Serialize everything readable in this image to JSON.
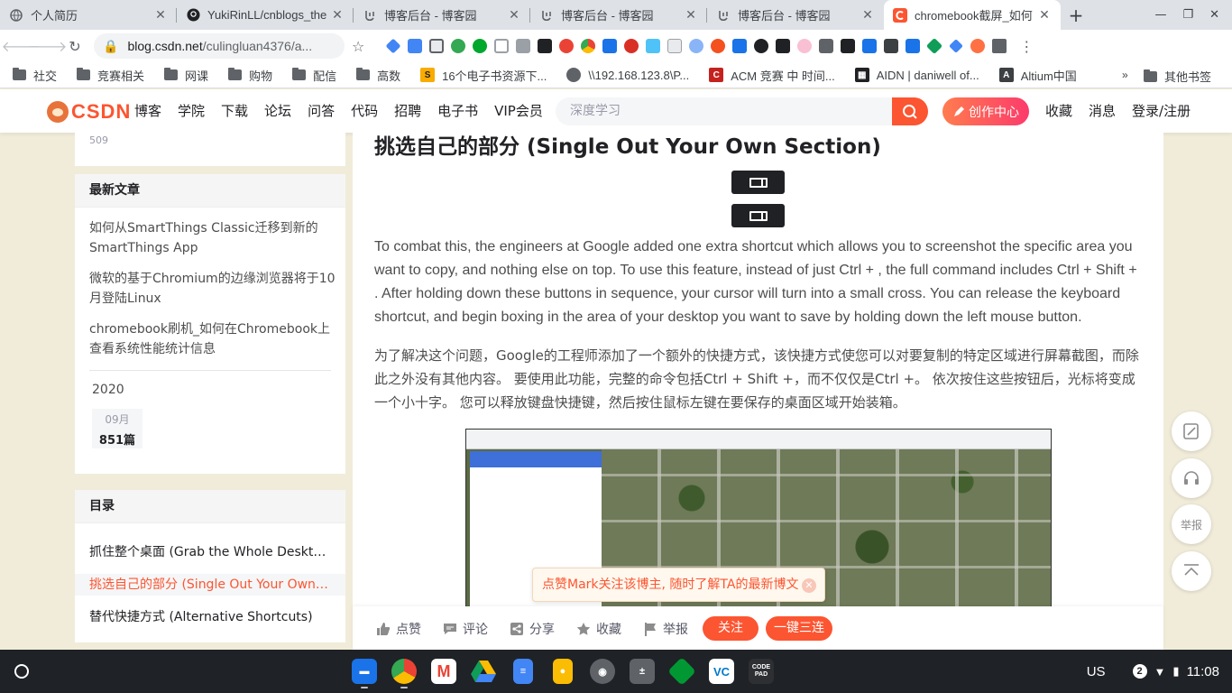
{
  "browser": {
    "tabs": [
      {
        "title": "个人简历",
        "icon": "globe-icon",
        "active": false
      },
      {
        "title": "YukiRinLL/cnblogs_the",
        "icon": "github-icon",
        "active": false
      },
      {
        "title": "博客后台 - 博客园",
        "icon": "cnblogs-icon",
        "active": false
      },
      {
        "title": "博客后台 - 博客园",
        "icon": "cnblogs-icon",
        "active": false
      },
      {
        "title": "博客后台 - 博客园",
        "icon": "cnblogs-icon",
        "active": false
      },
      {
        "title": "chromebook截屏_如何",
        "icon": "csdn-icon",
        "active": true
      }
    ],
    "url_host": "blog.csdn.net",
    "url_path": "/culingluan4376/a...",
    "bookmarks": [
      {
        "label": "社交",
        "type": "folder"
      },
      {
        "label": "竞赛相关",
        "type": "folder"
      },
      {
        "label": "网课",
        "type": "folder"
      },
      {
        "label": "购物",
        "type": "folder"
      },
      {
        "label": "配信",
        "type": "folder"
      },
      {
        "label": "高数",
        "type": "folder"
      },
      {
        "label": "16个电子书资源下...",
        "type": "site",
        "icon": "s-icon"
      },
      {
        "label": "\\\\192.168.123.8\\P...",
        "type": "site",
        "icon": "globe-icon"
      },
      {
        "label": "ACM 竞赛 中 时间...",
        "type": "site",
        "icon": "c-icon"
      },
      {
        "label": "AIDN | daniwell of...",
        "type": "site",
        "icon": "qr-icon"
      },
      {
        "label": "Altium中国",
        "type": "site",
        "icon": "altium-icon"
      }
    ],
    "bookmarks_more": "»",
    "bookmarks_other": "其他书签"
  },
  "csdn": {
    "logo_text": "CSDN",
    "nav": [
      "博客",
      "学院",
      "下载",
      "论坛",
      "问答",
      "代码",
      "招聘",
      "电子书",
      "VIP会员"
    ],
    "search_placeholder": "深度学习",
    "create_label": "创作中心",
    "right_nav": [
      "收藏",
      "消息",
      "登录/注册"
    ]
  },
  "sidebar": {
    "count_top": "509",
    "recent_title": "最新文章",
    "recent_articles": [
      "如何从SmartThings Classic迁移到新的SmartThings App",
      "微软的基于Chromium的边缘浏览器将于10月登陆Linux",
      "chromebook刷机_如何在Chromebook上查看系统性能统计信息"
    ],
    "archive_year": "2020",
    "archive_month": "09月",
    "archive_count": "851篇",
    "toc_title": "目录",
    "toc_items": [
      {
        "label": "抓住整个桌面 (Grab the Whole Desktop)",
        "active": false
      },
      {
        "label": "挑选自己的部分 (Single Out Your Own Section)",
        "active": true
      },
      {
        "label": "替代快捷方式 (Alternative Shortcuts)",
        "active": false
      }
    ]
  },
  "article": {
    "heading": "挑选自己的部分 (Single Out Your Own Section)",
    "para_en": "To combat this, the engineers at Google added one extra shortcut which allows you to screenshot the specific area you want to copy, and nothing else on top. To use this feature, instead of just Ctrl + , the full command includes Ctrl + Shift + . After holding down these buttons in sequence, your cursor will turn into a small cross. You can release the keyboard shortcut, and begin boxing in the area of your desktop you want to save by holding down the left mouse button.",
    "para_zh": "为了解决这个问题，Google的工程师添加了一个额外的快捷方式，该快捷方式使您可以对要复制的特定区域进行屏幕截图，而除此之外没有其他内容。 要使用此功能，完整的命令包括Ctrl + Shift +，而不仅仅是Ctrl +。 依次按住这些按钮后，光标将变成一个小十字。 您可以释放键盘快捷键，然后按住鼠标左键在要保存的桌面区域开始装箱。",
    "toast_text": "点赞Mark关注该博主, 随时了解TA的最新博文"
  },
  "actions": {
    "like": "点赞",
    "comment": "评论",
    "share": "分享",
    "favorite": "收藏",
    "report": "举报",
    "follow": "关注",
    "triple": "一键三连"
  },
  "float_tools": {
    "report": "举报"
  },
  "shelf": {
    "apps": [
      "files",
      "chrome",
      "gmail",
      "drive",
      "docs",
      "keep",
      "camera",
      "calculator",
      "vim",
      "vscode",
      "code-pad"
    ],
    "code_pad_label": "CODE PAD",
    "ime": "US",
    "notifications": "2",
    "time": "11:08"
  }
}
